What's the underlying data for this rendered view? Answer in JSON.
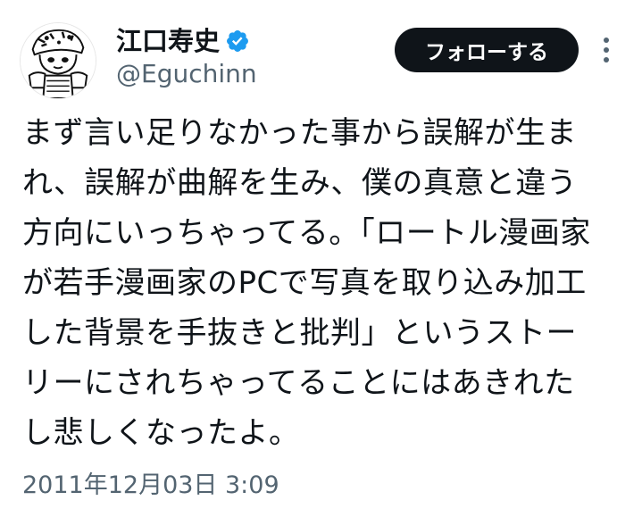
{
  "author": {
    "display_name": "江口寿史",
    "handle": "@Eguchinn",
    "verified": true,
    "verified_color": "#1d9bf0"
  },
  "actions": {
    "follow_label": "フォローする",
    "more_icon": "more-vertical-icon"
  },
  "tweet": {
    "lines": [
      "まず言い足りなかった事から誤解が生ま",
      "れ、誤解が曲解を生み、僕の真意と違う",
      "方向にいっちゃってる。「ロートル漫画家",
      "が若手漫画家のPCで写真を取り込み加工",
      "した背景を手抜きと批判」というストー",
      "リーにされちゃってることにはあきれた",
      "し悲しくなったよ。"
    ],
    "timestamp": "2011年12月03日 3:09"
  },
  "colors": {
    "text": "#0f1419",
    "secondary": "#536471",
    "button_bg": "#0f1419"
  }
}
